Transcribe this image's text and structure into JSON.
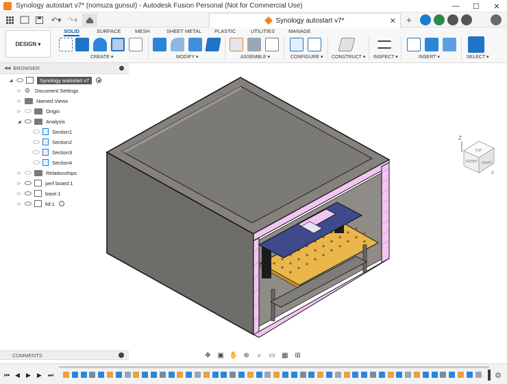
{
  "window": {
    "title": "Synology autostart v7* (nomuza gunsul) - Autodesk Fusion Personal (Not for Commercial Use)",
    "controls": [
      "—",
      "☐",
      "✕"
    ]
  },
  "document_tab": {
    "title": "Synology autostart v7*",
    "close": "✕"
  },
  "toolbar": {
    "workspace": "DESIGN ▾",
    "tabs": [
      {
        "label": "SOLID",
        "active": true
      },
      {
        "label": "SURFACE",
        "active": false
      },
      {
        "label": "MESH",
        "active": false
      },
      {
        "label": "SHEET METAL",
        "active": false
      },
      {
        "label": "PLASTIC",
        "active": false
      },
      {
        "label": "UTILITIES",
        "active": false
      },
      {
        "label": "MANAGE",
        "active": false
      }
    ],
    "groups": [
      {
        "label": "CREATE ▾"
      },
      {
        "label": "MODIFY ▾"
      },
      {
        "label": "ASSEMBLE ▾"
      },
      {
        "label": "CONFIGURE ▾"
      },
      {
        "label": "CONSTRUCT ▾"
      },
      {
        "label": "INSPECT ▾"
      },
      {
        "label": "INSERT ▾"
      },
      {
        "label": "SELECT ▾"
      }
    ]
  },
  "browser": {
    "header": "BROWSER",
    "root": "Synology autostart v7",
    "items": [
      {
        "label": "Document Settings"
      },
      {
        "label": "Named Views"
      },
      {
        "label": "Origin"
      },
      {
        "label": "Analysis"
      },
      {
        "label": "Section1"
      },
      {
        "label": "Section2"
      },
      {
        "label": "Section3"
      },
      {
        "label": "Section4"
      },
      {
        "label": "Relationships"
      },
      {
        "label": "perf board:1"
      },
      {
        "label": "base:1"
      },
      {
        "label": "lid:1"
      }
    ]
  },
  "comments": {
    "label": "COMMENTS"
  },
  "viewcube": {
    "axis_z": "Z",
    "face_top": "TOP",
    "face_front": "FRONT",
    "face_right": "RIGHT",
    "axis_x": "X"
  },
  "colors": {
    "accent": "#0a64b4",
    "model_gray": "#7d7b78",
    "section_pink": "#f2c6f2",
    "perf_board": "#e8b64a",
    "component_blue": "#3f4a8c"
  }
}
